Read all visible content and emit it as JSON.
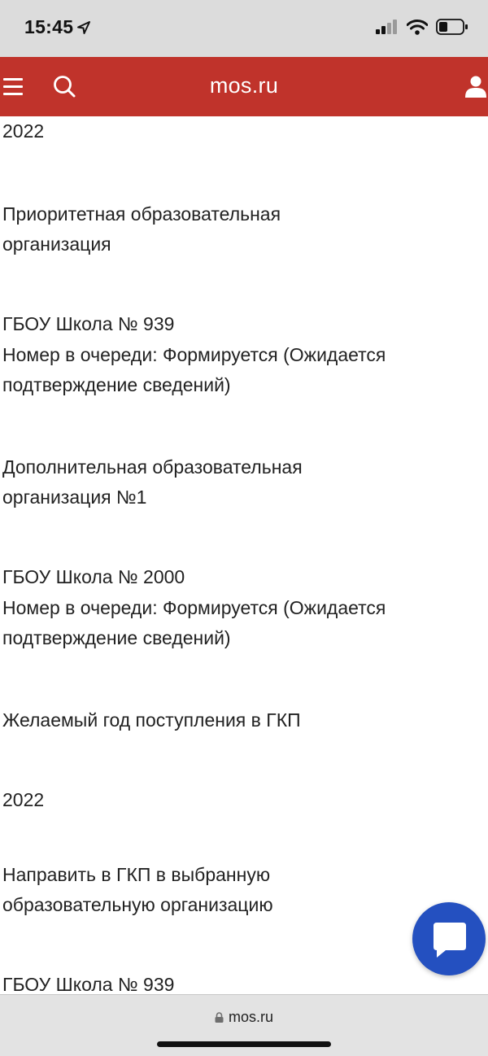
{
  "status_bar": {
    "time": "15:45"
  },
  "header": {
    "logo": "mos.ru",
    "accent_color": "#c0332b"
  },
  "content": {
    "lines": [
      "2022",
      "Приоритетная образовательная",
      "организация",
      "ГБОУ Школа № 939",
      "Номер в очереди: Формируется (Ожидается",
      "подтверждение сведений)",
      "Дополнительная образовательная",
      "организация №1",
      "ГБОУ Школа № 2000",
      "Номер в очереди: Формируется (Ожидается",
      "подтверждение сведений)",
      "Желаемый год поступления в ГКП",
      "2022",
      "Направить в ГКП в выбранную",
      "образовательную организацию",
      "ГБОУ Школа № 939"
    ]
  },
  "chat_button": {
    "icon": "chat-bubble-icon",
    "color": "#2450c0"
  },
  "browser_bar": {
    "url": "mos.ru",
    "lock_icon": "lock-icon"
  }
}
